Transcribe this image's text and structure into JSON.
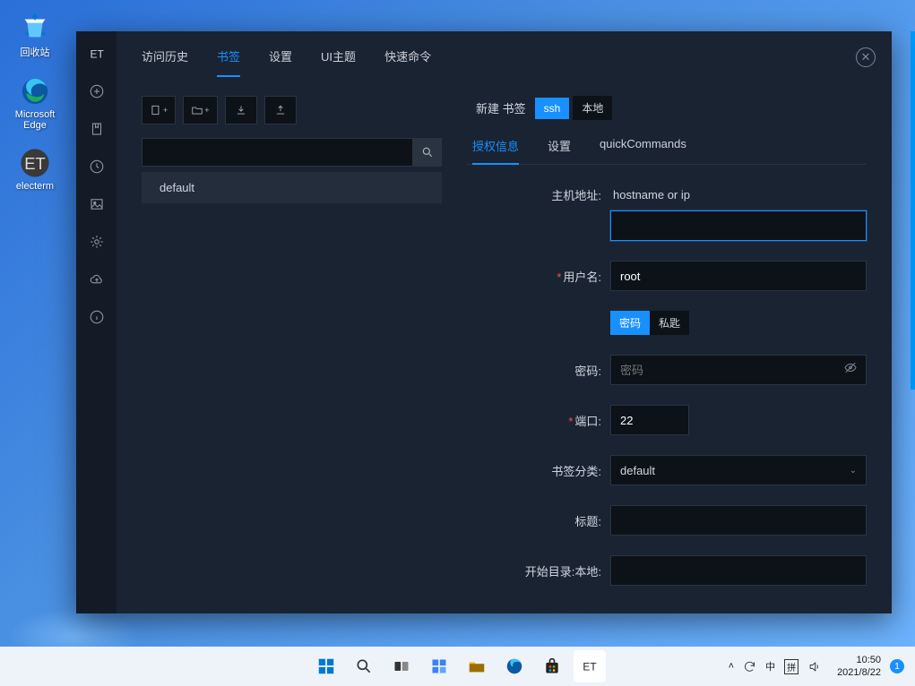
{
  "desktop": {
    "icons": [
      {
        "name": "回收站"
      },
      {
        "name": "Microsoft Edge"
      },
      {
        "name": "electerm"
      }
    ]
  },
  "app": {
    "tabs": [
      {
        "label": "访问历史"
      },
      {
        "label": "书签"
      },
      {
        "label": "设置"
      },
      {
        "label": "UI主题"
      },
      {
        "label": "快速命令"
      }
    ],
    "active_tab": 1,
    "list_item": "default",
    "new_label": "新建 书签",
    "segments": {
      "ssh": "ssh",
      "local": "本地"
    },
    "subtabs": [
      {
        "label": "授权信息"
      },
      {
        "label": "设置"
      },
      {
        "label": "quickCommands"
      }
    ],
    "active_subtab": 0,
    "form": {
      "host_label": "主机地址:",
      "host_hint": "hostname or ip",
      "host_value": "",
      "user_label": "用户名:",
      "user_value": "root",
      "auth_pwd": "密码",
      "auth_key": "私匙",
      "pwd_label": "密码:",
      "pwd_placeholder": "密码",
      "port_label": "端口:",
      "port_value": "22",
      "cat_label": "书签分类:",
      "cat_value": "default",
      "title_label": "标题:",
      "title_value": "",
      "startdir_label": "开始目录:本地:",
      "startdir_value": ""
    }
  },
  "taskbar": {
    "time": "10:50",
    "date": "2021/8/22",
    "lang": "中",
    "badge": "1",
    "spell": "拼"
  }
}
